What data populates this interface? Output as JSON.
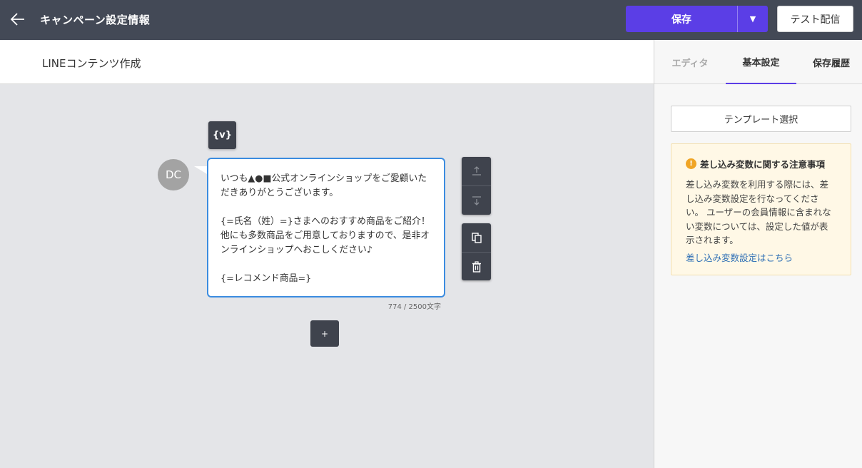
{
  "header": {
    "title": "キャンペーン設定情報",
    "save_label": "保存",
    "test_label": "テスト配信"
  },
  "subheader": {
    "title": "LINEコンテンツ作成"
  },
  "tabs": [
    "エディタ",
    "基本設定",
    "保存履歴"
  ],
  "active_tab": "基本設定",
  "panel": {
    "template_label": "テンプレート選択",
    "notice_title": "差し込み変数に関する注意事項",
    "notice_body": "差し込み変数を利用する際には、差し込み変数設定を行なってください。 ユーザーの会員情報に含まれない変数については、設定した値が表示されます。",
    "notice_link": "差し込み変数設定はこちら"
  },
  "editor": {
    "var_label": "{v}",
    "avatar": "DC",
    "message": "いつも▲●■公式オンラインショップをご愛顧いただきありがとうございます。\n\n{=氏名（姓）=}さまへのおすすめ商品をご紹介！\n他にも多数商品をご用意しておりますので、是非オンラインショップへおこしください♪\n\n{=レコメンド商品=}",
    "char_count": "774 / 2500文字",
    "add_label": "+"
  },
  "colors": {
    "topbar": "#434956",
    "accent": "#5b3ee6",
    "bubble_border": "#3b8ce0",
    "link": "#2f6fb5"
  },
  "icons": {
    "back": "arrow-left-icon",
    "dropdown": "caret-down-icon",
    "info": "info-icon",
    "move_up": "move-up-icon",
    "move_down": "move-down-icon",
    "copy": "copy-icon",
    "delete": "trash-icon"
  }
}
